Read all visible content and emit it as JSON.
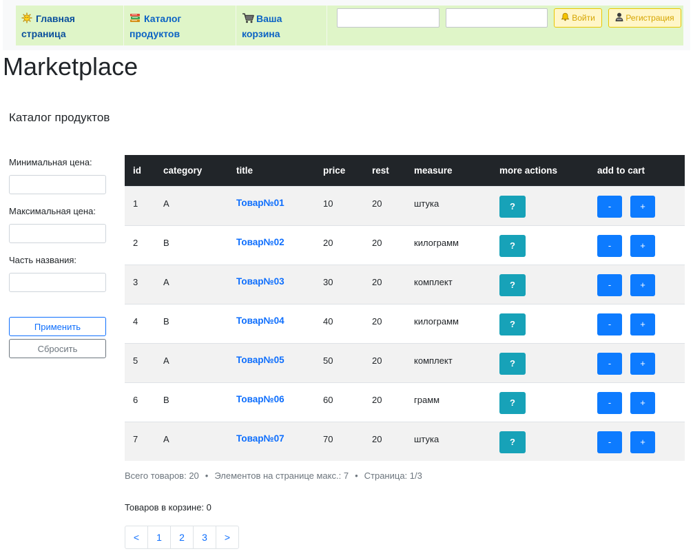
{
  "nav": {
    "home": {
      "line1": "Главная",
      "line2": "страница",
      "icon": "sun-icon"
    },
    "catalog": {
      "line1": "Каталог",
      "line2": "продуктов",
      "icon": "books-icon"
    },
    "cart": {
      "line1": "Ваша",
      "line2": "корзина",
      "icon": "cart-icon"
    },
    "login_label": "Войти",
    "register_label": "Регистрация",
    "login_value": "",
    "password_value": ""
  },
  "app_title": "Marketplace",
  "section_title": "Каталог продуктов",
  "filters": {
    "min_price_label": "Минимальная цена:",
    "max_price_label": "Максимальная цена:",
    "name_part_label": "Часть названия:",
    "min_price_value": "",
    "max_price_value": "",
    "name_part_value": "",
    "apply_label": "Применить",
    "reset_label": "Сбросить"
  },
  "table": {
    "headers": [
      "id",
      "category",
      "title",
      "price",
      "rest",
      "measure",
      "more actions",
      "add to cart"
    ],
    "info_label": "?",
    "minus_label": "-",
    "plus_label": "+",
    "rows": [
      {
        "id": "1",
        "category": "A",
        "title": "Товар№01",
        "price": "10",
        "rest": "20",
        "measure": "штука"
      },
      {
        "id": "2",
        "category": "B",
        "title": "Товар№02",
        "price": "20",
        "rest": "20",
        "measure": "килограмм"
      },
      {
        "id": "3",
        "category": "A",
        "title": "Товар№03",
        "price": "30",
        "rest": "20",
        "measure": "комплект"
      },
      {
        "id": "4",
        "category": "B",
        "title": "Товар№04",
        "price": "40",
        "rest": "20",
        "measure": "килограмм"
      },
      {
        "id": "5",
        "category": "A",
        "title": "Товар№05",
        "price": "50",
        "rest": "20",
        "measure": "комплект"
      },
      {
        "id": "6",
        "category": "B",
        "title": "Товар№06",
        "price": "60",
        "rest": "20",
        "measure": "грамм"
      },
      {
        "id": "7",
        "category": "A",
        "title": "Товар№07",
        "price": "70",
        "rest": "20",
        "measure": "штука"
      }
    ]
  },
  "summary": {
    "total": "Всего товаров: 20",
    "per_page": "Элементов на странице макс.: 7",
    "page": "Страница: 1/3",
    "separator": "•"
  },
  "cart_count": "Товаров в корзине: 0",
  "pagination": [
    "<",
    "1",
    "2",
    "3",
    ">"
  ],
  "colors": {
    "nav_bg": "#dff5c8",
    "header_bg": "#212529",
    "link": "#0d6efd",
    "info_button": "#17a2b8",
    "qty_button": "#0d7bff",
    "auth_button_bg": "#fff6c8"
  }
}
